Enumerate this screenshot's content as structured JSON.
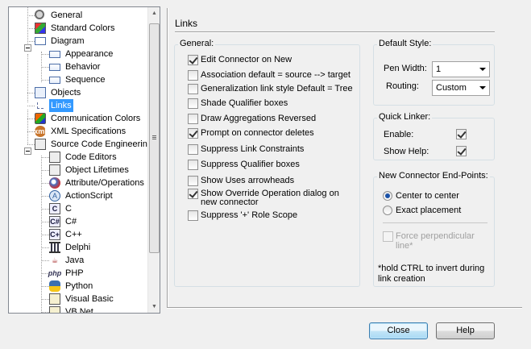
{
  "tree": {
    "items": [
      {
        "label": "General",
        "icon": "gear-icon"
      },
      {
        "label": "Standard Colors",
        "icon": "palette-icon"
      },
      {
        "label": "Diagram",
        "icon": "folder-icon"
      },
      {
        "label": "Appearance",
        "icon": "document-icon"
      },
      {
        "label": "Behavior",
        "icon": "document-icon"
      },
      {
        "label": "Sequence",
        "icon": "document-icon"
      },
      {
        "label": "Objects",
        "icon": "objects-icon"
      },
      {
        "label": "Links",
        "icon": "link-icon"
      },
      {
        "label": "Communication Colors",
        "icon": "color-palette-icon"
      },
      {
        "label": "XML Specifications",
        "icon": "xml-icon"
      },
      {
        "label": "Source Code Engineering",
        "icon": "code-folder-icon"
      },
      {
        "label": "Code Editors",
        "icon": "code-editor-icon"
      },
      {
        "label": "Object Lifetimes",
        "icon": "object-lifetime-icon"
      },
      {
        "label": "Attribute/Operations",
        "icon": "attribute-icon"
      },
      {
        "label": "ActionScript",
        "icon": "actionscript-icon"
      },
      {
        "label": "C",
        "icon": "c-icon",
        "glyph": "C"
      },
      {
        "label": "C#",
        "icon": "csharp-icon",
        "glyph": "C#"
      },
      {
        "label": "C++",
        "icon": "cpp-icon",
        "glyph": "C+"
      },
      {
        "label": "Delphi",
        "icon": "delphi-icon"
      },
      {
        "label": "Java",
        "icon": "java-icon"
      },
      {
        "label": "PHP",
        "icon": "php-icon",
        "glyph": "php"
      },
      {
        "label": "Python",
        "icon": "python-icon"
      },
      {
        "label": "Visual Basic",
        "icon": "visual-basic-icon"
      },
      {
        "label": "VB.Net",
        "icon": "vbnet-icon"
      }
    ],
    "selected": "Links"
  },
  "page": {
    "title": "Links"
  },
  "general": {
    "title": "General:",
    "options": [
      {
        "label": "Edit Connector on New",
        "checked": true
      },
      {
        "label": "Association default = source --> target",
        "checked": false
      },
      {
        "label": "Generalization link style Default = Tree",
        "checked": false
      },
      {
        "label": "Shade Qualifier boxes",
        "checked": false
      },
      {
        "label": "Draw Aggregations Reversed",
        "checked": false
      },
      {
        "label": "Prompt on connector deletes",
        "checked": true
      },
      {
        "label": "Suppress Link Constraints",
        "checked": false
      },
      {
        "label": "Suppress Qualifier boxes",
        "checked": false
      },
      {
        "label": "Show Uses arrowheads",
        "checked": false
      },
      {
        "label": "Show Override Operation dialog on",
        "label2": "new connector",
        "checked": true
      },
      {
        "label": "Suppress '+' Role Scope",
        "checked": false
      }
    ]
  },
  "default_style": {
    "title": "Default Style:",
    "pen_width_label": "Pen Width:",
    "pen_width_value": "1",
    "routing_label": "Routing:",
    "routing_value": "Custom"
  },
  "quick_linker": {
    "title": "Quick Linker:",
    "enable_label": "Enable:",
    "enable_checked": true,
    "show_help_label": "Show Help:",
    "show_help_checked": true
  },
  "end_points": {
    "title": "New Connector End-Points:",
    "center_label": "Center to center",
    "center_selected": true,
    "exact_label": "Exact placement",
    "exact_selected": false,
    "force_label": "Force perpendicular",
    "force_label2": "line*",
    "force_checked": false,
    "note_line1": "*hold CTRL to invert during",
    "note_line2": "link creation"
  },
  "buttons": {
    "close": "Close",
    "help": "Help"
  }
}
